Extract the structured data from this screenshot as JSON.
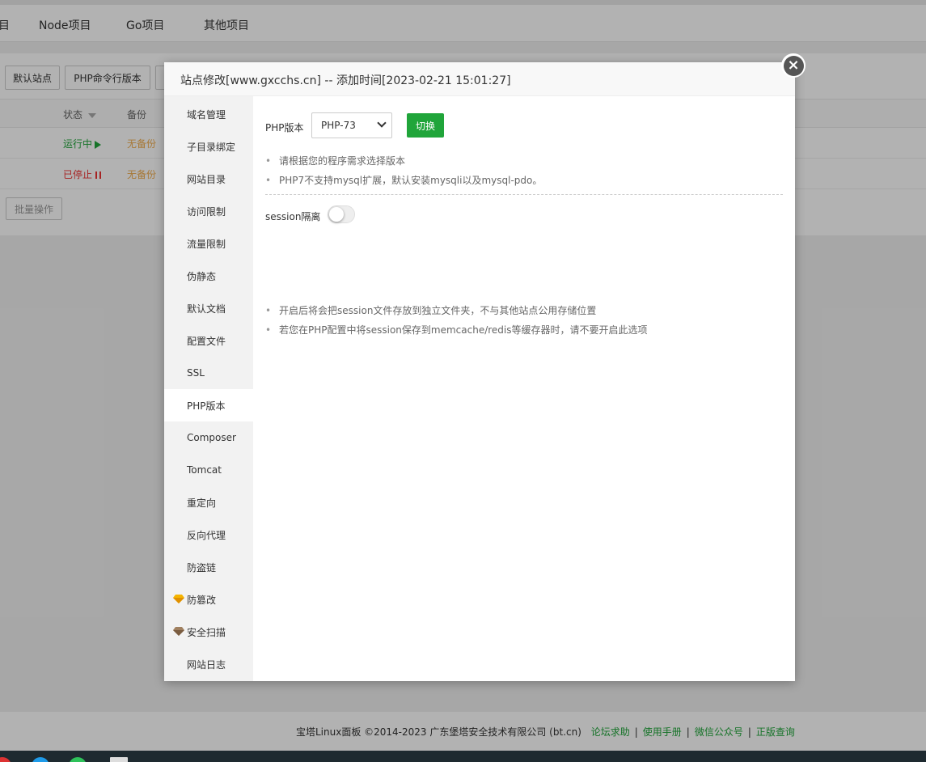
{
  "background": {
    "nav": [
      "目",
      "Node项目",
      "Go项目",
      "其他项目"
    ],
    "toolbar_buttons": [
      "默认站点",
      "PHP命令行版本"
    ],
    "table_headers": {
      "status": "状态",
      "backup": "备份"
    },
    "rows": [
      {
        "status": "运行中",
        "backup": "无备份"
      },
      {
        "status": "已停止",
        "backup": "无备份"
      }
    ],
    "batch_button": "批量操作",
    "footer": {
      "copyright": "宝塔Linux面板 ©2014-2023 广东堡塔安全技术有限公司 (bt.cn)",
      "links": [
        "论坛求助",
        "使用手册",
        "微信公众号",
        "正版查询"
      ]
    }
  },
  "modal": {
    "title": "站点修改[www.gxcchs.cn] -- 添加时间[2023-02-21 15:01:27]",
    "sidebar": [
      {
        "label": "域名管理"
      },
      {
        "label": "子目录绑定"
      },
      {
        "label": "网站目录"
      },
      {
        "label": "访问限制"
      },
      {
        "label": "流量限制"
      },
      {
        "label": "伪静态"
      },
      {
        "label": "默认文档"
      },
      {
        "label": "配置文件"
      },
      {
        "label": "SSL"
      },
      {
        "label": "PHP版本"
      },
      {
        "label": "Composer"
      },
      {
        "label": "Tomcat"
      },
      {
        "label": "重定向"
      },
      {
        "label": "反向代理"
      },
      {
        "label": "防盗链"
      },
      {
        "label": "防篡改"
      },
      {
        "label": "安全扫描"
      },
      {
        "label": "网站日志"
      }
    ],
    "active_item": "PHP版本",
    "php": {
      "label": "PHP版本",
      "selected": "PHP-73",
      "switch_label": "切换",
      "tips": [
        "请根据您的程序需求选择版本",
        "PHP7不支持mysql扩展，默认安装mysqli以及mysql-pdo。"
      ]
    },
    "session": {
      "label": "session隔离",
      "enabled": false,
      "tips": [
        "开启后将会把session文件存放到独立文件夹，不与其他站点公用存储位置",
        "若您在PHP配置中将session保存到memcache/redis等缓存器时，请不要开启此选项"
      ]
    }
  },
  "colors": {
    "accent": "#20a53a",
    "stopped": "#ee3333",
    "warning": "#f0ad4e"
  }
}
